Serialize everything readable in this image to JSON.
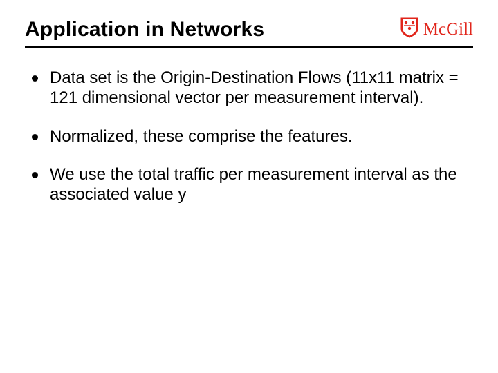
{
  "header": {
    "title": "Application in Networks",
    "logo_text": "McGill"
  },
  "bullets": [
    "Data set is the Origin-Destination Flows (11x11 matrix = 121 dimensional vector per measurement interval).",
    "Normalized, these comprise the features.",
    "We use the total traffic per measurement interval as the associated value y"
  ]
}
